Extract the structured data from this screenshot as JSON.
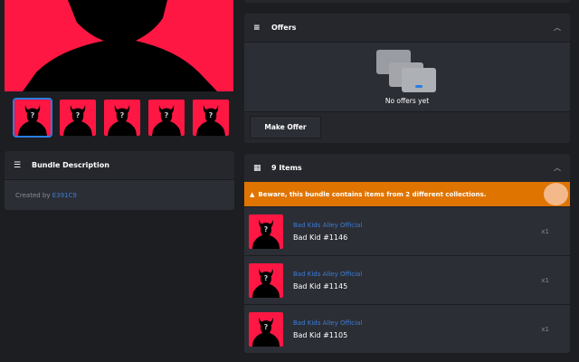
{
  "description": {
    "title": "Bundle Description",
    "created_by_label": "Created by",
    "creator": "E391C9"
  },
  "offers": {
    "title": "Offers",
    "empty_text": "No offers yet",
    "make_offer": "Make Offer"
  },
  "items": {
    "title": "9 Items",
    "warning": "Beware, this bundle contains items from 2 different collections.",
    "list": [
      {
        "collection": "Bad Kids Alley Official",
        "name": "Bad Kid #1146",
        "qty": "x1"
      },
      {
        "collection": "Bad Kids Alley Official",
        "name": "Bad Kid #1145",
        "qty": "x1"
      },
      {
        "collection": "Bad Kids Alley Official",
        "name": "Bad Kid #1105",
        "qty": "x1"
      }
    ]
  },
  "colors": {
    "accent": "#2a7de1",
    "warning": "#e07400",
    "nft_bg": "#ff1744"
  }
}
